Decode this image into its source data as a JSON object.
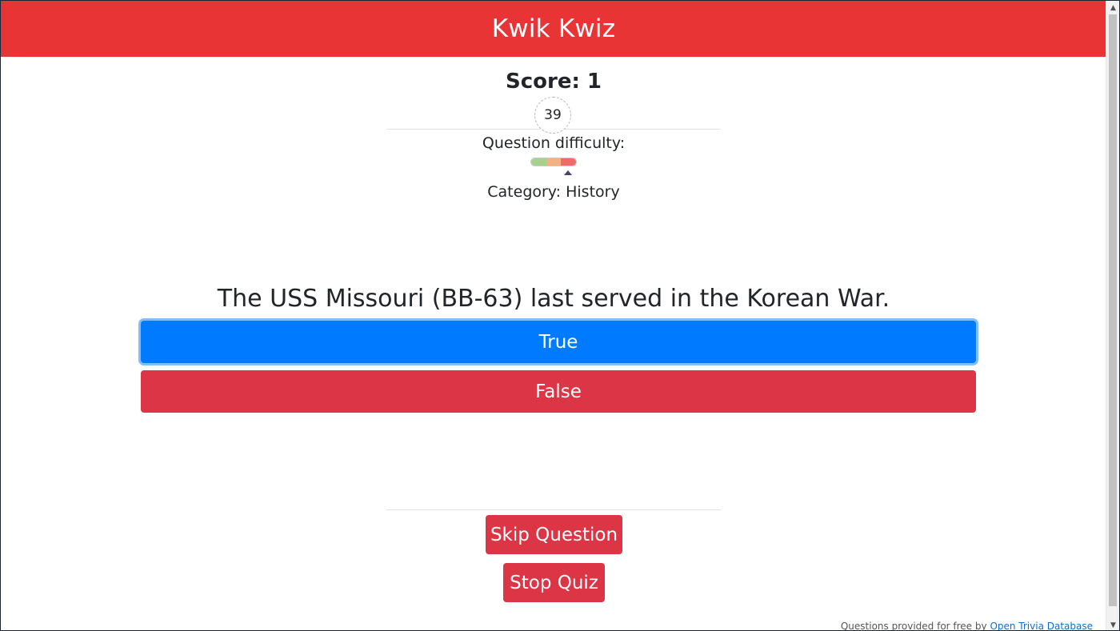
{
  "header": {
    "title": "Kwik Kwiz"
  },
  "score": {
    "label": "Score: 1"
  },
  "timer": {
    "seconds": "39"
  },
  "difficulty": {
    "label": "Question difficulty:",
    "levels": [
      "#a9d18e",
      "#f4b183",
      "#f06a6a"
    ],
    "selected_index": 2
  },
  "category": {
    "label": "Category: History"
  },
  "question": {
    "text": "The USS Missouri (BB-63) last served in the Korean War."
  },
  "answers": {
    "true_label": "True",
    "false_label": "False"
  },
  "actions": {
    "skip_label": "Skip Question",
    "stop_label": "Stop Quiz"
  },
  "footer": {
    "prefix": "Questions provided for free by",
    "link": "Open Trivia Database"
  },
  "colors": {
    "header": "#e83434",
    "primary": "#007bff",
    "danger": "#dc3545"
  }
}
